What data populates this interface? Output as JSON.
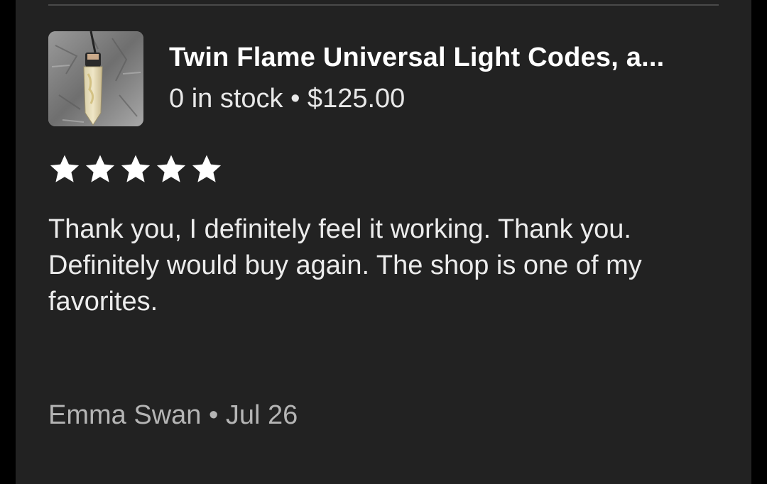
{
  "product": {
    "title": "Twin Flame Universal Light Codes, a...",
    "meta": "0 in stock • $125.00",
    "thumbnail_icon": "crystal-pendant-image"
  },
  "review": {
    "rating": 5,
    "rating_max": 5,
    "star_color": "#ffffff",
    "text": "Thank you, I definitely feel it working. Thank you. Definitely would buy again. The shop is one of my favorites.",
    "reviewer_line": "Emma Swan • Jul 26"
  },
  "colors": {
    "background": "#000000",
    "panel": "#222222",
    "text_primary": "#ffffff",
    "text_secondary": "#b5b5b5"
  }
}
